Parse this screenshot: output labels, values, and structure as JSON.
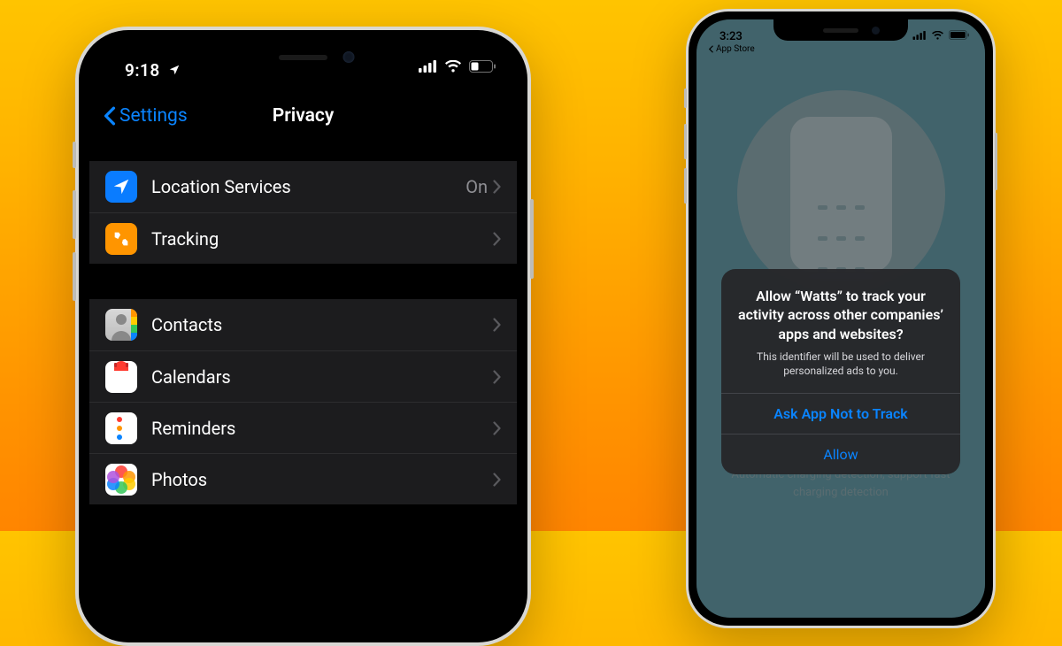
{
  "left": {
    "status_time": "9:18",
    "nav_back": "Settings",
    "nav_title": "Privacy",
    "group1": [
      {
        "label": "Location Services",
        "value": "On",
        "icon": "location",
        "color": "#0a7cff"
      },
      {
        "label": "Tracking",
        "value": "",
        "icon": "tracking",
        "color": "#ff9500"
      }
    ],
    "group2": [
      {
        "label": "Contacts",
        "icon": "contacts"
      },
      {
        "label": "Calendars",
        "icon": "calendar"
      },
      {
        "label": "Reminders",
        "icon": "reminders"
      },
      {
        "label": "Photos",
        "icon": "photos"
      }
    ]
  },
  "right": {
    "status_time": "3:23",
    "breadcrumb": "App Store",
    "dialog_title": "Allow “Watts” to track your activity across other companies’ apps and websites?",
    "dialog_message": "This identifier will be used to deliver personalized ads to you.",
    "btn_deny": "Ask App Not to Track",
    "btn_allow": "Allow",
    "caption": "Automatic charging detection, support fast charging detection"
  }
}
